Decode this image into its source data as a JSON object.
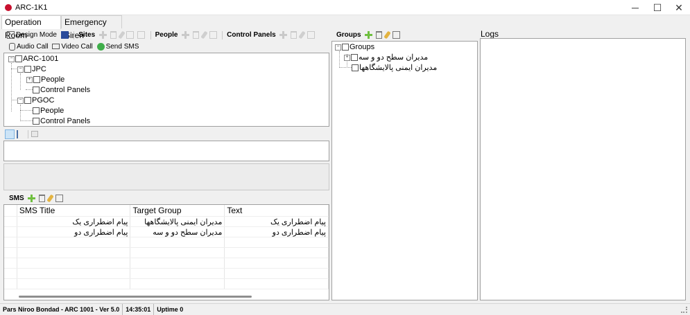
{
  "window": {
    "title": "ARC-1K1",
    "minimize": "─",
    "maximize": "☐",
    "close": "✕"
  },
  "tabs": [
    "Operation Room",
    "Emergency Siren"
  ],
  "toolbar": {
    "design_mode": "Design Mode",
    "sites": "Sites",
    "people": "People",
    "control_panels": "Control Panels",
    "audio_call": "Audio Call",
    "video_call": "Video Call",
    "send_sms": "Send SMS"
  },
  "site_tree": {
    "root": "ARC-1001",
    "jpc": "JPC",
    "jpc_people": "People",
    "jpc_control_panels": "Control Panels",
    "pgoc": "PGOC",
    "pgoc_people": "People",
    "pgoc_control_panels": "Control Panels"
  },
  "sms": {
    "label": "SMS",
    "columns": [
      "SMS Title",
      "Target Group",
      "Text"
    ],
    "rows": [
      [
        "پیام اضطراری یک",
        "مدیران ایمنی پالایشگاهها",
        "پیام اضطراری یک"
      ],
      [
        "پیام اضطراری دو",
        "مدیران سطح دو و سه",
        "پیام اضطراری دو"
      ]
    ]
  },
  "groups": {
    "label": "Groups",
    "root": "Groups",
    "items": [
      "مدیران سطح دو و سه",
      "مدیران ایمنی پالایشگاهها"
    ]
  },
  "logs": {
    "label": "Logs"
  },
  "status": {
    "product": "Pars Niroo Bondad - ARC 1001 - Ver 5.0",
    "time": "14:35:01",
    "uptime": "Uptime 0"
  },
  "colors": {
    "accent_green": "#6fbf3f",
    "close_red": "#c8102e"
  }
}
